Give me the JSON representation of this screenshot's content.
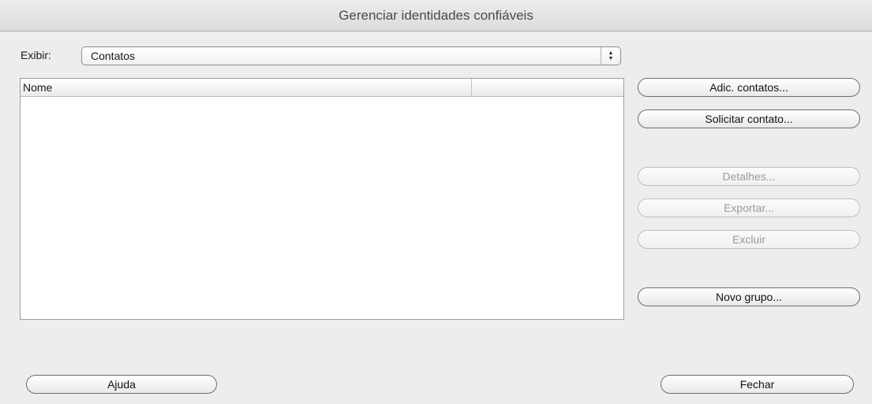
{
  "window": {
    "title": "Gerenciar identidades confiáveis"
  },
  "filter": {
    "label": "Exibir:",
    "selected": "Contatos"
  },
  "table": {
    "columns": [
      "Nome",
      ""
    ],
    "rows": []
  },
  "actions": {
    "add_contacts": "Adic. contatos...",
    "request_contact": "Solicitar contato...",
    "details": "Detalhes...",
    "export": "Exportar...",
    "delete": "Excluir",
    "new_group": "Novo grupo..."
  },
  "footer": {
    "help": "Ajuda",
    "close": "Fechar"
  },
  "icons": {
    "select_arrows": "updown-arrows-icon"
  }
}
